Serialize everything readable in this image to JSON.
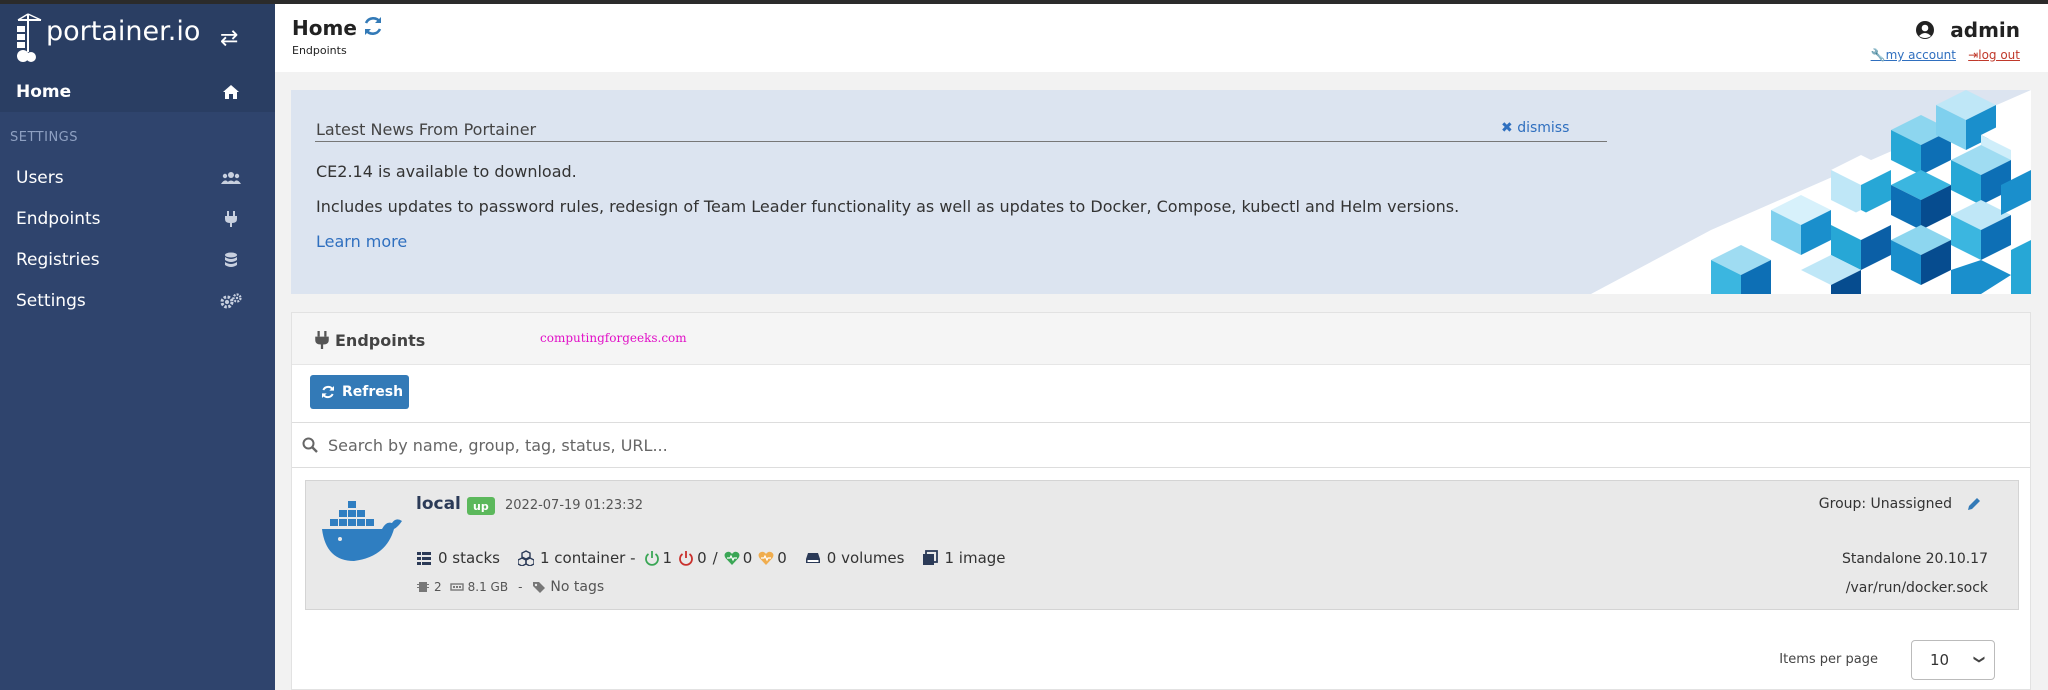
{
  "brand": {
    "name": "portainer.io"
  },
  "sidebar": {
    "home_label": "Home",
    "settings_heading": "SETTINGS",
    "items": [
      {
        "label": "Users",
        "icon": "users-icon"
      },
      {
        "label": "Endpoints",
        "icon": "plug-icon"
      },
      {
        "label": "Registries",
        "icon": "database-icon"
      },
      {
        "label": "Settings",
        "icon": "cogs-icon"
      }
    ]
  },
  "header": {
    "title": "Home",
    "breadcrumb": "Endpoints",
    "user": "admin",
    "my_account": "my account",
    "log_out": "log out"
  },
  "news": {
    "title": "Latest News From Portainer",
    "dismiss": "dismiss",
    "line1": "CE2.14 is available to download.",
    "line2": "Includes updates to password rules, redesign of Team Leader functionality as well as updates to Docker, Compose, kubectl and Helm versions.",
    "learn_more": "Learn more"
  },
  "endpoints": {
    "title": "Endpoints",
    "watermark": "computingforgeeks.com",
    "refresh_label": "Refresh",
    "search_placeholder": "Search by name, group, tag, status, URL...",
    "items": [
      {
        "name": "local",
        "status": "up",
        "timestamp": "2022-07-19 01:23:32",
        "group": "Group: Unassigned",
        "stacks": "0 stacks",
        "containers": "1 container -",
        "running": "1",
        "stopped": "0",
        "healthy": "0",
        "unhealthy": "0",
        "volumes": "0 volumes",
        "images": "1 image",
        "cpu": "2",
        "memory": "8.1 GB",
        "tags": "No tags",
        "version": "Standalone 20.10.17",
        "url": "/var/run/docker.sock"
      }
    ],
    "items_per_page_label": "Items per page",
    "items_per_page_value": "10"
  },
  "colors": {
    "sidebar": "#2f446d",
    "accent": "#337ab7",
    "status_up": "#5cb85c",
    "news_bg": "#dce4f0"
  }
}
